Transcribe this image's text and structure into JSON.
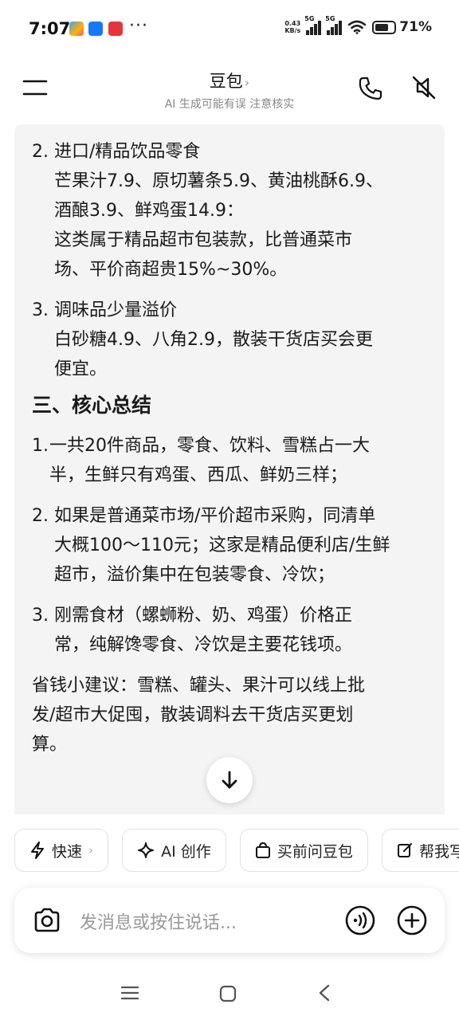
{
  "status_bar": {
    "time": "7:07",
    "net_speed": "0.43",
    "net_unit": "KB/s",
    "sig1": "5G",
    "sig2": "5G",
    "battery": "71%",
    "battery_level": 0.71,
    "more": "···"
  },
  "header": {
    "title": "豆包",
    "title_chevron": "›",
    "subtitle": "AI 生成可能有误 注意核实"
  },
  "message": {
    "section2": {
      "item2_num": "2.",
      "item2_title": "进口/精品饮品零食",
      "item2_line1": "芒果汁7.9、原切薯条5.9、黄油桃酥6.9、",
      "item2_line2": "酒酿3.9、鲜鸡蛋14.9：",
      "item2_line3": "这类属于精品超市包装款，比普通菜市",
      "item2_line4": "场、平价商超贵15%~30%。",
      "item3_num": "3.",
      "item3_title": "调味品少量溢价",
      "item3_line1": "白砂糖4.9、八角2.9，散装干货店买会更",
      "item3_line2": "便宜。"
    },
    "section3_title": "三、核心总结",
    "summary": [
      {
        "num": "1.",
        "l1": "一共20件商品，零食、饮料、雪糕占一大",
        "l2": "半，生鲜只有鸡蛋、西瓜、鲜奶三样；",
        "l3": ""
      },
      {
        "num": "2.",
        "l1": "如果是普通菜市场/平价超市采购，同清单",
        "l2": "大概100～110元；这家是精品便利店/生鲜",
        "l3": "超市，溢价集中在包装零食、冷饮；"
      },
      {
        "num": "3.",
        "l1": "刚需食材（螺蛳粉、奶、鸡蛋）价格正",
        "l2": "常，纯解馋零食、冷饮是主要花钱项。",
        "l3": ""
      }
    ],
    "tip_l1": "省钱小建议：雪糕、罐头、果汁可以线上批",
    "tip_l2": "发/超市大促囤，散装调料去干货店买更划",
    "tip_l3": "算。"
  },
  "chips": {
    "fast": "快速",
    "fast_chevron": "›",
    "ai_create": "AI 创作",
    "ask_before_buy": "买前问豆包",
    "help_write": "帮我写"
  },
  "input": {
    "placeholder": "发消息或按住说话..."
  }
}
